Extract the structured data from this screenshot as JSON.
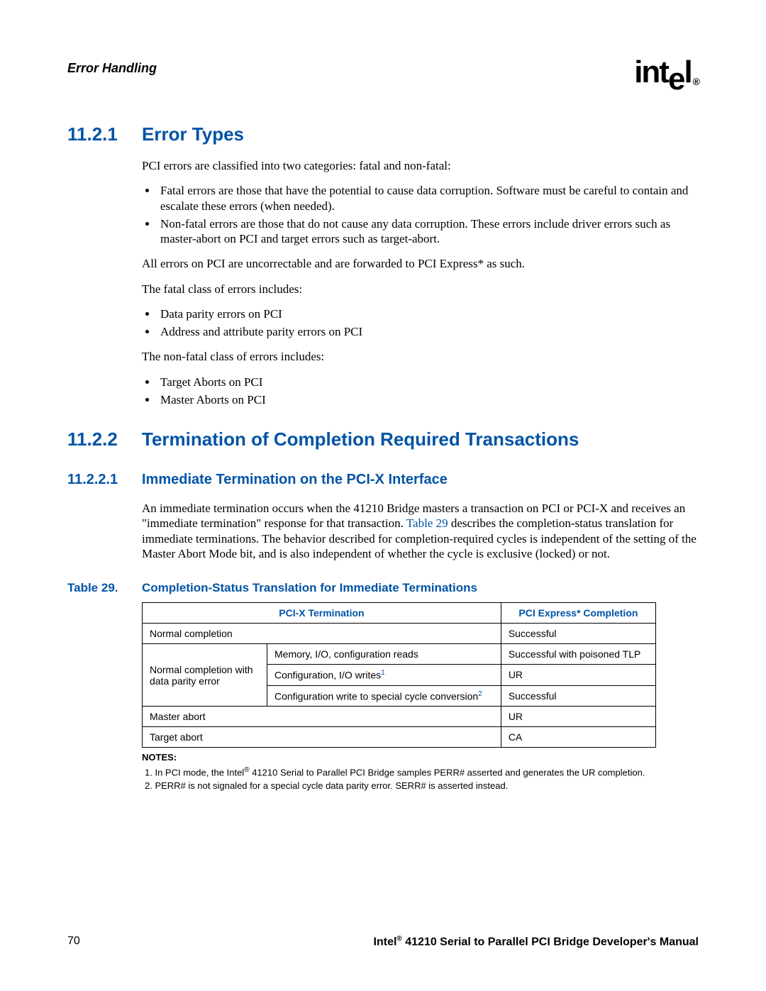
{
  "header": {
    "section_title": "Error Handling",
    "logo_text": "intel"
  },
  "sections": {
    "s1": {
      "number": "11.2.1",
      "title": "Error Types",
      "intro": "PCI errors are classified into two categories: fatal and non-fatal:",
      "bullets1": [
        "Fatal errors are those that have the potential to cause data corruption. Software must be careful to contain and escalate these errors (when needed).",
        "Non-fatal errors are those that do not cause any data corruption. These errors include driver errors such as master-abort on PCI and target errors such as target-abort."
      ],
      "para2": "All errors on PCI are uncorrectable and are forwarded to PCI Express* as such.",
      "para3": "The fatal class of errors includes:",
      "bullets2": [
        "Data parity errors on PCI",
        "Address and attribute parity errors on PCI"
      ],
      "para4": "The non-fatal class of errors includes:",
      "bullets3": [
        "Target Aborts on PCI",
        "Master Aborts on PCI"
      ]
    },
    "s2": {
      "number": "11.2.2",
      "title": "Termination of Completion Required Transactions"
    },
    "s3": {
      "number": "11.2.2.1",
      "title": "Immediate Termination on the PCI-X Interface",
      "para_a": "An immediate termination occurs when the 41210 Bridge masters a transaction on PCI or PCI-X and receives an \"immediate termination\" response for that transaction. ",
      "link": "Table 29",
      "para_b": " describes the completion-status translation for immediate terminations. The behavior described for completion-required cycles is independent of the setting of the Master Abort Mode bit, and is also independent of whether the cycle is exclusive (locked) or not."
    }
  },
  "table": {
    "caption_label": "Table 29.",
    "caption_title": "Completion-Status Translation for Immediate Terminations",
    "headers": [
      "PCI-X Termination",
      "PCI Express* Completion"
    ],
    "rows": {
      "r1c1": "Normal completion",
      "r1c2": "Successful",
      "group_label": "Normal completion with data parity error",
      "r2c1": "Memory, I/O, configuration reads",
      "r2c2": "Successful with poisoned TLP",
      "r3c1": "Configuration, I/O writes",
      "r3c2": "UR",
      "r4c1": "Configuration write to special cycle conversion",
      "r4c2": "Successful",
      "r5c1": "Master abort",
      "r5c2": "UR",
      "r6c1": "Target abort",
      "r6c2": "CA"
    }
  },
  "notes": {
    "heading": "NOTES:",
    "n1_a": "1. In PCI mode, the Intel",
    "n1_b": " 41210 Serial to Parallel PCI Bridge samples PERR# asserted and generates the UR completion.",
    "n2": "2. PERR# is not signaled for a special cycle data parity error. SERR# is asserted instead."
  },
  "footer": {
    "page_number": "70",
    "doc_a": "Intel",
    "doc_b": " 41210 Serial to Parallel PCI Bridge Developer's Manual"
  }
}
